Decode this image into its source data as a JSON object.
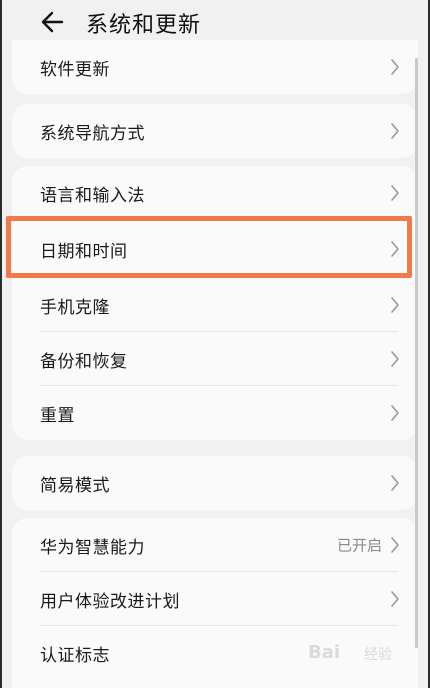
{
  "header": {
    "title": "系统和更新",
    "back_icon": "back-arrow-icon"
  },
  "groups": [
    {
      "items": [
        {
          "label": "软件更新"
        }
      ]
    },
    {
      "items": [
        {
          "label": "系统导航方式"
        }
      ]
    },
    {
      "items": [
        {
          "label": "语言和输入法"
        },
        {
          "label": "日期和时间"
        },
        {
          "label": "手机克隆"
        },
        {
          "label": "备份和恢复"
        },
        {
          "label": "重置"
        }
      ]
    },
    {
      "items": [
        {
          "label": "简易模式"
        }
      ]
    },
    {
      "items": [
        {
          "label": "华为智慧能力",
          "value": "已开启"
        },
        {
          "label": "用户体验改进计划"
        },
        {
          "label": "认证标志"
        }
      ]
    }
  ],
  "watermark": {
    "text": "Bai",
    "text2": "经验"
  },
  "colors": {
    "background": "#f1f1f1",
    "card": "#fafafa",
    "highlight": "#f07a4a",
    "secondary_text": "#8a8a8a"
  }
}
